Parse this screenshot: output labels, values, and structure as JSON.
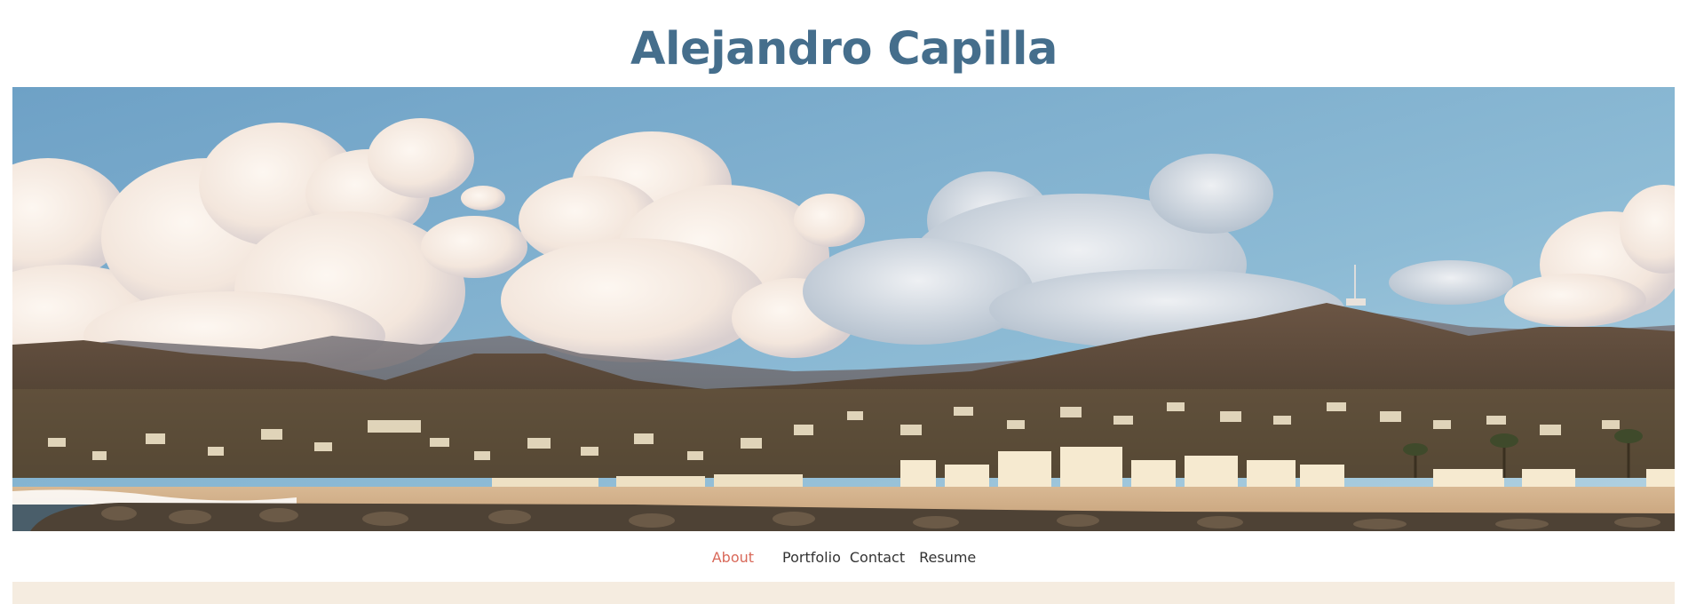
{
  "site": {
    "title": "Alejandro Capilla"
  },
  "hero": {
    "image_alt": "Panoramic beach town with hills and clouds"
  },
  "nav": {
    "items": [
      {
        "label": "About",
        "active": true
      },
      {
        "label": "Portfolio",
        "active": false
      },
      {
        "label": "Contact",
        "active": false
      },
      {
        "label": "Resume",
        "active": false
      }
    ]
  },
  "colors": {
    "title": "#456e8c",
    "active_nav": "#d9695a",
    "nav_text": "#333333",
    "content_bg": "#f5ece0"
  }
}
